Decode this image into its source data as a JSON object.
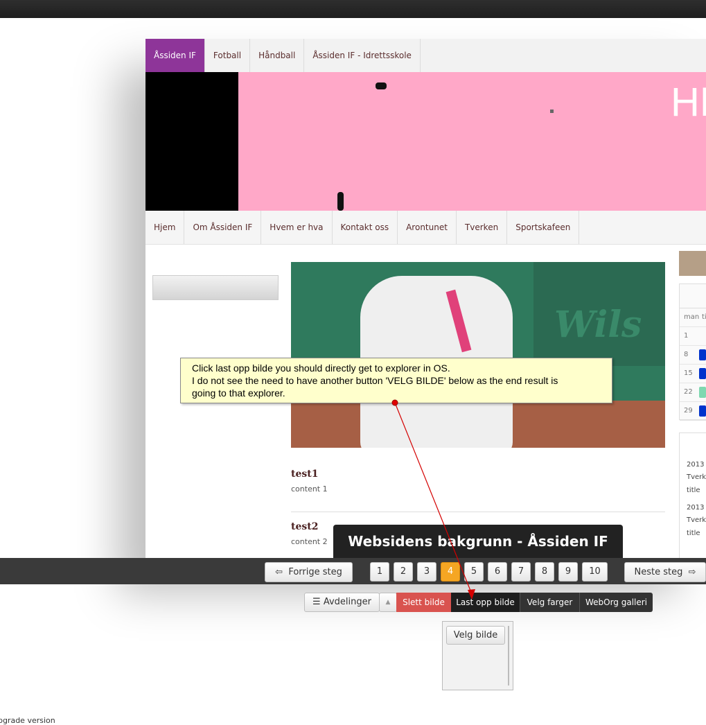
{
  "site_tabs": [
    "Åssiden IF",
    "Fotball",
    "Håndball",
    "Åssiden IF - Idrettsskole"
  ],
  "banner_logo": "HE",
  "nav_items": [
    "Hjem",
    "Om Åssiden IF",
    "Hvem er hva",
    "Kontakt oss",
    "Arontunet",
    "Tverken",
    "Sportskafeen"
  ],
  "hero_brand": "Wils",
  "articles": [
    {
      "title": "test1",
      "body": "content 1"
    },
    {
      "title": "test2",
      "body": "content 2"
    }
  ],
  "calendar": {
    "weekday_labels": [
      "man",
      "ti"
    ],
    "days": [
      "1",
      "8",
      "15",
      "22",
      "29"
    ]
  },
  "news": [
    "2013",
    "Tverk",
    "title",
    "2013",
    "Tverk",
    "title"
  ],
  "callout": {
    "line1": "Click last opp bilde you should directly get to explorer in OS.",
    "line2": "I do not see the need to have another button 'VELG BILDE' below as the end result is",
    "line3": "going to that explorer."
  },
  "tooltip": "Websidens bakgrunn - Åssiden IF",
  "stepper": {
    "prev": "Forrige steg",
    "next": "Neste steg",
    "steps": [
      "1",
      "2",
      "3",
      "4",
      "5",
      "6",
      "7",
      "8",
      "9",
      "10"
    ],
    "active_step": "4"
  },
  "toolbar": {
    "departments": "Avdelinger",
    "delete_image": "Slett bilde",
    "upload_image": "Last opp bilde",
    "choose_colors": "Velg farger",
    "gallery": "WebOrg galleri"
  },
  "choose_image": "Velg bilde",
  "footer": "upgrade version",
  "colors": {
    "accent_purple": "#8e3599",
    "banner_pink": "#ffa8c8",
    "active_step": "#f5a623",
    "delete_red": "#d9534f"
  }
}
